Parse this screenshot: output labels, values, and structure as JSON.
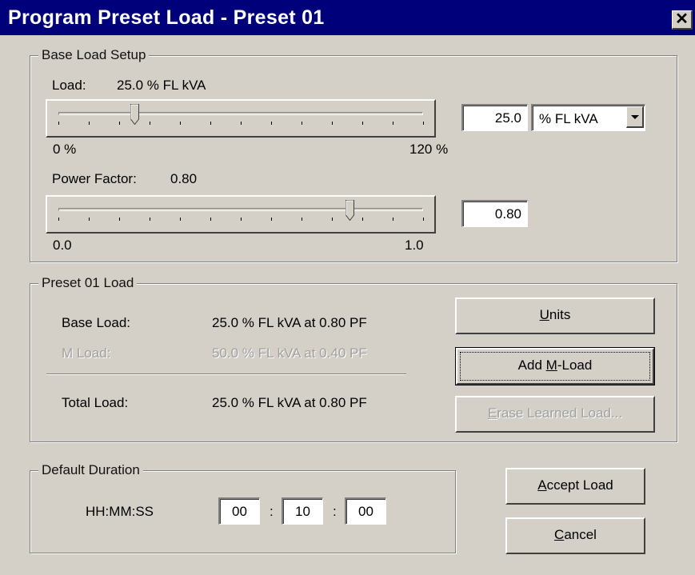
{
  "window": {
    "title": "Program Preset Load - Preset 01",
    "close_glyph": "✕"
  },
  "base_load_setup": {
    "legend": "Base Load Setup",
    "load_label": "Load:",
    "load_value_text": "25.0 % FL kVA",
    "load_slider": {
      "value": 25.0,
      "min": 0,
      "max": 120,
      "min_label": "0 %",
      "max_label": "120 %"
    },
    "load_input": "25.0",
    "units_select": "% FL kVA",
    "pf_label": "Power Factor:",
    "pf_value_text": "0.80",
    "pf_slider": {
      "value": 0.8,
      "min": 0.0,
      "max": 1.0,
      "min_label": "0.0",
      "max_label": "1.0"
    },
    "pf_input": "0.80"
  },
  "preset_load": {
    "legend": "Preset 01 Load",
    "rows": [
      {
        "label": "Base Load:",
        "value": "25.0 % FL kVA at 0.80 PF",
        "disabled": false
      },
      {
        "label": "M Load:",
        "value": "50.0 % FL kVA at 0.40 PF",
        "disabled": true
      },
      {
        "label": "Total Load:",
        "value": "25.0 % FL kVA at 0.80 PF",
        "disabled": false
      }
    ],
    "buttons": {
      "units": {
        "mnemonic": "U",
        "rest": "nits"
      },
      "add_mload": {
        "pre": "Add ",
        "mnemonic": "M",
        "rest": "-Load"
      },
      "erase": {
        "mnemonic": "E",
        "rest": "rase Learned Load..."
      }
    }
  },
  "default_duration": {
    "legend": "Default Duration",
    "label": "HH:MM:SS",
    "hh": "00",
    "mm": "10",
    "ss": "00",
    "separator": ":"
  },
  "actions": {
    "accept": {
      "mnemonic": "A",
      "rest": "ccept Load"
    },
    "cancel": {
      "mnemonic": "C",
      "rest": "ancel"
    }
  },
  "icons": {
    "close": "close-icon",
    "dropdown": "chevron-down-icon",
    "slider_thumb": "slider-thumb-icon"
  }
}
